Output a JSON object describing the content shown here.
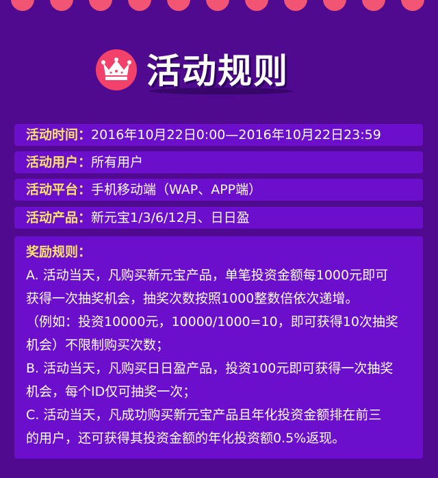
{
  "header": {
    "title": "活动规则",
    "icon": "crown-icon",
    "accent_color": "#f2416a"
  },
  "info": [
    {
      "label": "活动时间：",
      "value": "2016年10月22日0:00—2016年10月22日23:59"
    },
    {
      "label": "活动用户：",
      "value": "所有用户"
    },
    {
      "label": "活动平台：",
      "value": "手机移动端（WAP、APP端）"
    },
    {
      "label": "活动产品：",
      "value": "新元宝1/3/6/12月、日日盈"
    }
  ],
  "rules": {
    "heading": "奖励规则：",
    "lines": [
      "A. 活动当天，凡购买新元宝产品，单笔投资金额每1000元即可",
      "获得一次抽奖机会，抽奖次数按照1000整数倍依次递增。",
      "（例如：投资10000元，10000/1000=10，即可获得10次抽奖",
      "机会）不限制购买次数；",
      "B. 活动当天，凡购买日日盈产品，投资100元即可获得一次抽奖",
      "机会，每个ID仅可抽奖一次；",
      "C. 活动当天，凡成功购买新元宝产品且年化投资金额排在前三",
      "的用户，还可获得其投资金额的年化投资额0.5%返现。"
    ]
  },
  "colors": {
    "background": "#4f0a8f",
    "panel": "#6c0fcc",
    "label": "#ffe36a",
    "dot": "#f25473"
  }
}
